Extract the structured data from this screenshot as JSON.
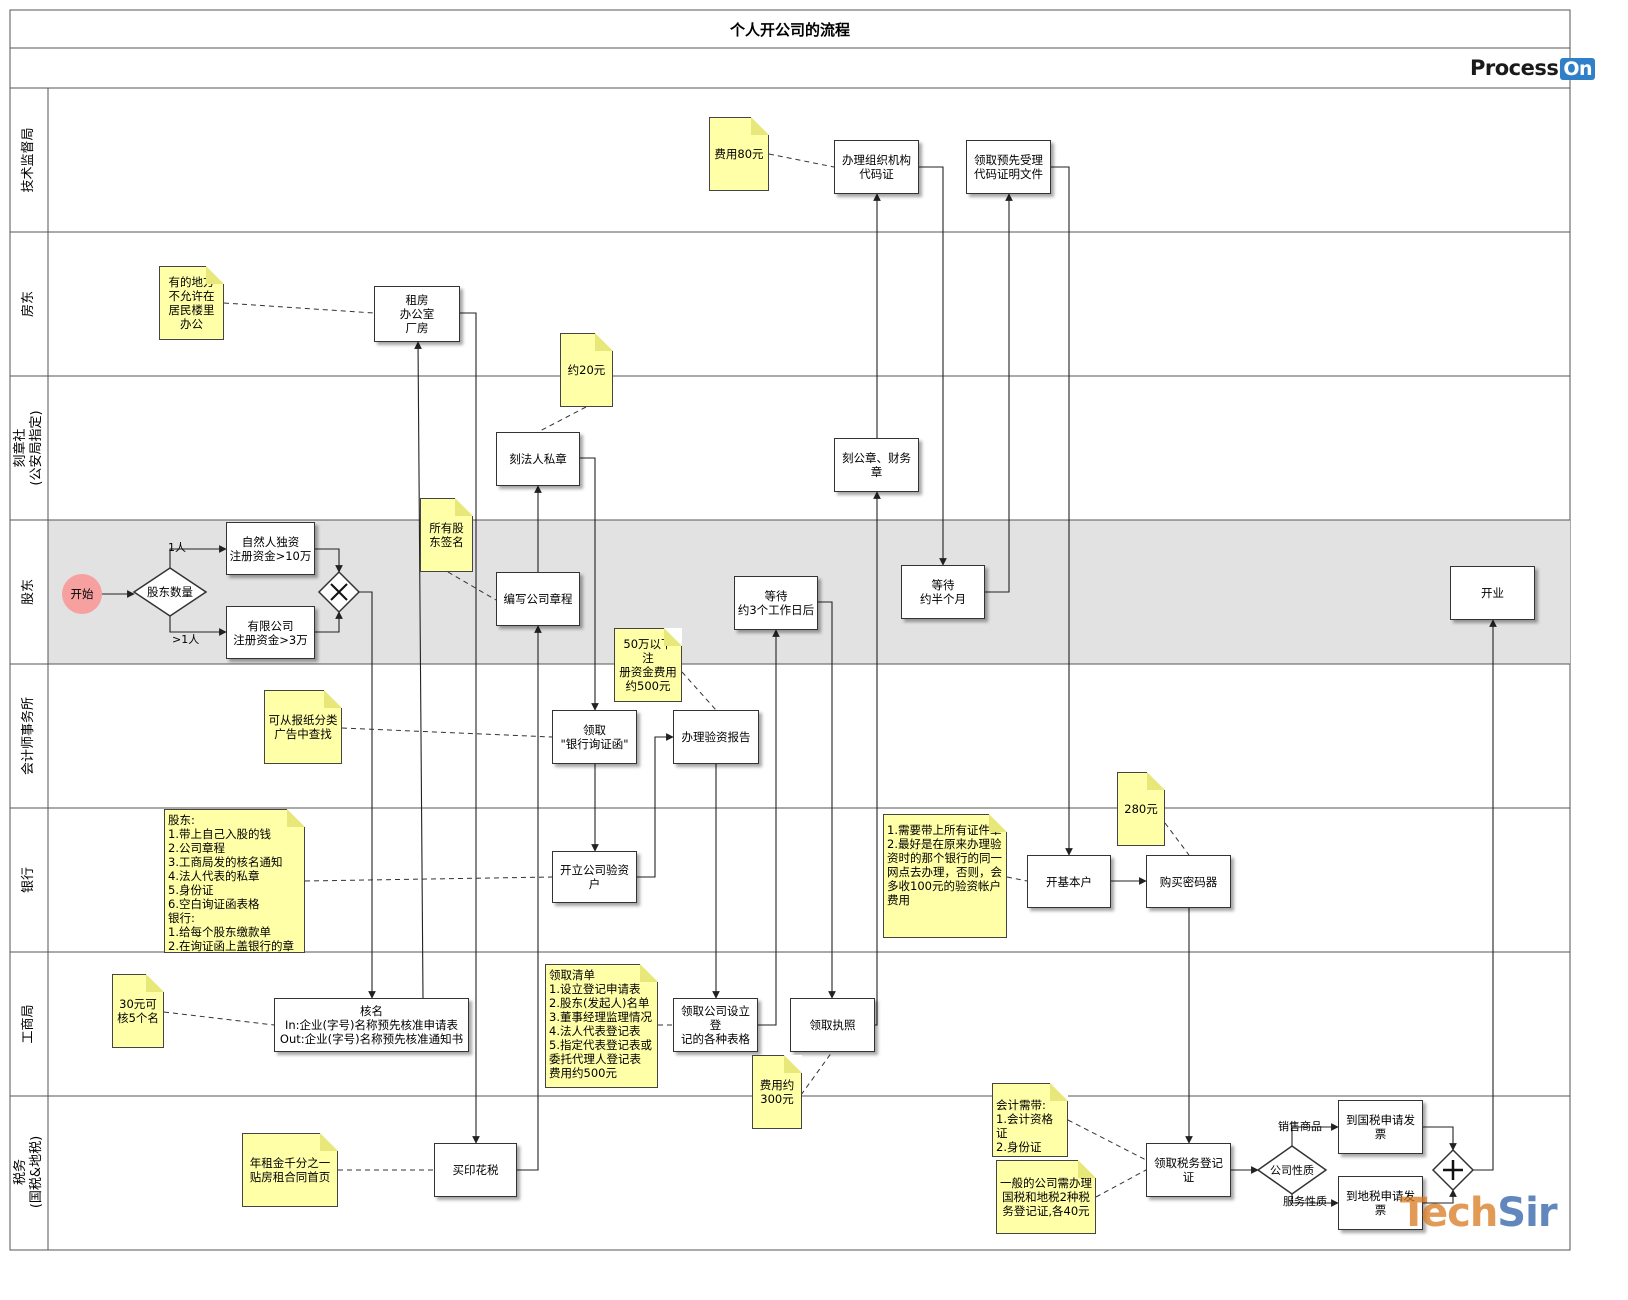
{
  "title": "个人开公司的流程",
  "logo": {
    "text": "Process",
    "suffix": "On"
  },
  "lanes": [
    "技术监督局",
    "房东",
    "刻章社\n(公安局指定)",
    "股东",
    "会计师事务所",
    "银行",
    "工商局",
    "税务\n(国税&地税)"
  ],
  "start": "开始",
  "decisions": {
    "shareholders": "股东数量",
    "company_type": "公司性质"
  },
  "edge_labels": {
    "one": "1人",
    "more": ">1人",
    "sale": "销售商品",
    "service": "服务性质"
  },
  "boxes": {
    "sole": "自然人独资\n注册资金>10万",
    "llc": "有限公司\n注册资金>3万",
    "rent": "租房\n办公室\n厂房",
    "seal": "刻法人私章",
    "articles": "编写公司章程",
    "inquiry": "领取\n\"银行询证函\"",
    "account": "开立公司验资\n户",
    "verify": "办理验资报告",
    "naming": "核名\nIn:企业(字号)名称预先核准申请表\nOut:企业(字号)名称预先核准通知书",
    "forms": "领取公司设立登\n记的各种表格",
    "license": "领取执照",
    "wait3": "等待\n约3个工作日后",
    "corp_seal": "刻公章、财务\n章",
    "org_code": "办理组织机构\n代码证",
    "wait_half": "等待\n约半个月",
    "pre_cert": "领取预先受理\n代码证明文件",
    "stamp": "买印花税",
    "basic_acct": "开基本户",
    "encoder": "购买密码器",
    "tax_reg": "领取税务登记\n证",
    "national": "到国税申请发\n票",
    "local": "到地税申请发\n票",
    "open": "开业"
  },
  "notes": {
    "landlord": "有的地方\n不允许在\n居民楼里\n办公",
    "seal_fee": "约20元",
    "sign": "所有股\n东签名",
    "code_fee": "费用80元",
    "capital_fee": "50万以下注\n册资金费用\n约500元",
    "newspaper": "可从报纸分类\n广告中查找",
    "bank_list": "股东:\n1.带上自己入股的钱\n2.公司章程\n3.工商局发的核名通知\n4.法人代表的私章\n5.身份证\n6.空白询证函表格\n银行:\n1.给每个股东缴款单\n2.在询证函上盖银行的章",
    "names": "30元可\n核5个名",
    "checklist": "领取清单\n1.设立登记申请表\n2.股东(发起人)名单\n3.董事经理监理情况\n4.法人代表登记表\n5.指定代表登记表或\n委托代理人登记表\n费用约500元",
    "license_fee": "费用约\n300元",
    "account_tips": "1.需要带上所有证件章\n2.最好是在原来办理验\n资时的那个银行的同一\n网点去办理，否则，会\n多收100元的验资帐户\n费用",
    "encoder_fee": "280元",
    "accountant": "会计需带:\n1.会计资格证\n2.身份证",
    "tax_fee": "一般的公司需办理\n国税和地税2种税\n务登记证,各40元",
    "rent_contract": "年租金千分之一\n贴房租合同首页"
  },
  "watermark": {
    "a": "Tech",
    "b": "Sir"
  }
}
